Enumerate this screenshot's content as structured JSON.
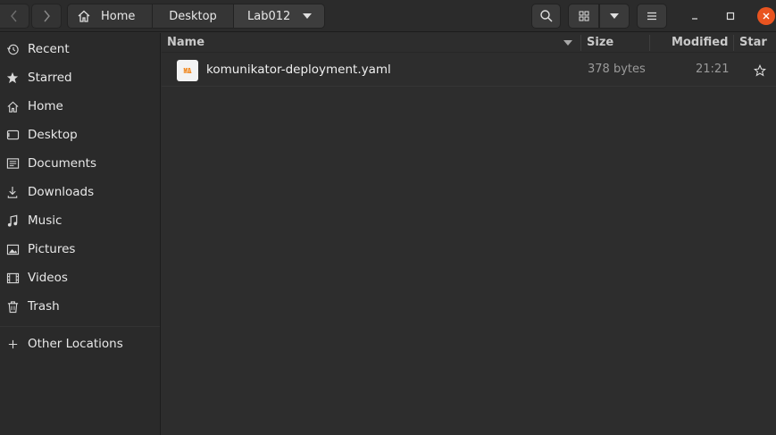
{
  "path": {
    "crumbs": [
      "Home",
      "Desktop",
      "Lab012"
    ]
  },
  "sidebar": {
    "items": [
      {
        "label": "Recent",
        "icon": "clock-icon"
      },
      {
        "label": "Starred",
        "icon": "star-icon"
      },
      {
        "label": "Home",
        "icon": "home-icon"
      },
      {
        "label": "Desktop",
        "icon": "desktop-icon"
      },
      {
        "label": "Documents",
        "icon": "document-icon"
      },
      {
        "label": "Downloads",
        "icon": "download-icon"
      },
      {
        "label": "Music",
        "icon": "music-icon"
      },
      {
        "label": "Pictures",
        "icon": "picture-icon"
      },
      {
        "label": "Videos",
        "icon": "video-icon"
      },
      {
        "label": "Trash",
        "icon": "trash-icon"
      }
    ],
    "other_locations": "Other Locations"
  },
  "columns": {
    "name": "Name",
    "size": "Size",
    "modified": "Modified",
    "star": "Star"
  },
  "files": [
    {
      "name": "komunikator-deployment.yaml",
      "size": "378 bytes",
      "modified": "21:21",
      "icon_text_top": "YA",
      "icon_text_bottom": "ML"
    }
  ],
  "colors": {
    "accent_close": "#e95420",
    "yaml_icon": "#f08a24"
  }
}
